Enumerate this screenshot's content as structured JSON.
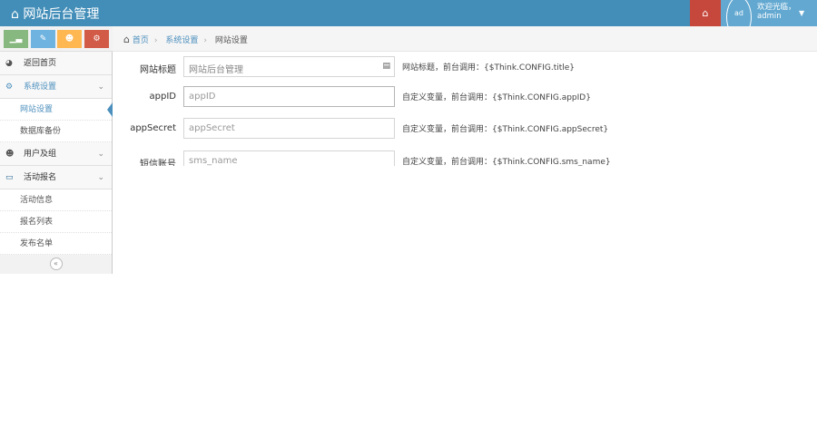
{
  "header": {
    "title": "网站后台管理",
    "welcome": "欢迎光临，",
    "username": "admin",
    "avatar_alt": "ad"
  },
  "breadcrumb": [
    "首页",
    "系统设置",
    "网站设置"
  ],
  "sidebar": {
    "items": [
      {
        "label": "返回首页"
      },
      {
        "label": "系统设置",
        "children": [
          "网站设置",
          "数据库备份"
        ]
      },
      {
        "label": "用户及组"
      },
      {
        "label": "活动报名",
        "children": [
          "活动信息",
          "报名列表",
          "发布名单"
        ]
      }
    ],
    "collapse": "«"
  },
  "form": [
    {
      "label": "网站标题",
      "value": "网站后台管理",
      "hint": "网站标题，前台调用：{$Think.CONFIG.title}"
    },
    {
      "label": "appID",
      "placeholder": "appID",
      "hint": "自定义变量，前台调用：{$Think.CONFIG.appID}"
    },
    {
      "label": "appSecret",
      "placeholder": "appSecret",
      "hint": "自定义变量，前台调用：{$Think.CONFIG.appSecret}"
    },
    {
      "label": "短信账号",
      "placeholder": "sms_name",
      "hint": "自定义变量，前台调用：{$Think.CONFIG.sms_name}"
    }
  ],
  "colors": {
    "nav": "#438eb9",
    "red": "#c6473b",
    "green": "#87b87f",
    "blue": "#6fb3e0",
    "orange": "#ffb752"
  }
}
